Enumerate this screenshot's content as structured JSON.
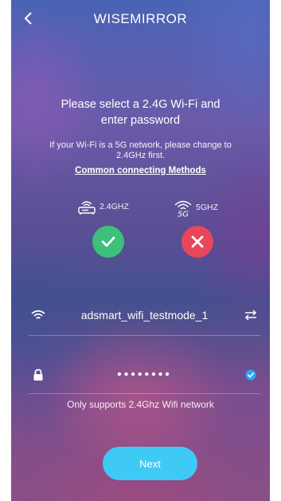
{
  "header": {
    "title": "WISEMIRROR",
    "back_icon": "chevron-left-icon"
  },
  "instructions": {
    "headline_line1": "Please select a 2.4G Wi-Fi and",
    "headline_line2": "enter password",
    "note_line1": "If your Wi-Fi is a 5G network, please change to",
    "note_line2": "2.4GHz first.",
    "link": "Common connecting Methods"
  },
  "bands": {
    "b24": {
      "label": "2.4GHZ",
      "status": "supported",
      "color": "#3cc07a"
    },
    "b5": {
      "label": "5GHZ",
      "badge": "5G",
      "status": "unsupported",
      "color": "#e8475b"
    }
  },
  "wifi": {
    "ssid": "adsmart_wifi_testmode_1"
  },
  "password": {
    "masked": "••••••••"
  },
  "support_text": "Only supports 2.4Ghz Wifi network",
  "next_button": {
    "label": "Next",
    "color": "#3fc9f5"
  }
}
